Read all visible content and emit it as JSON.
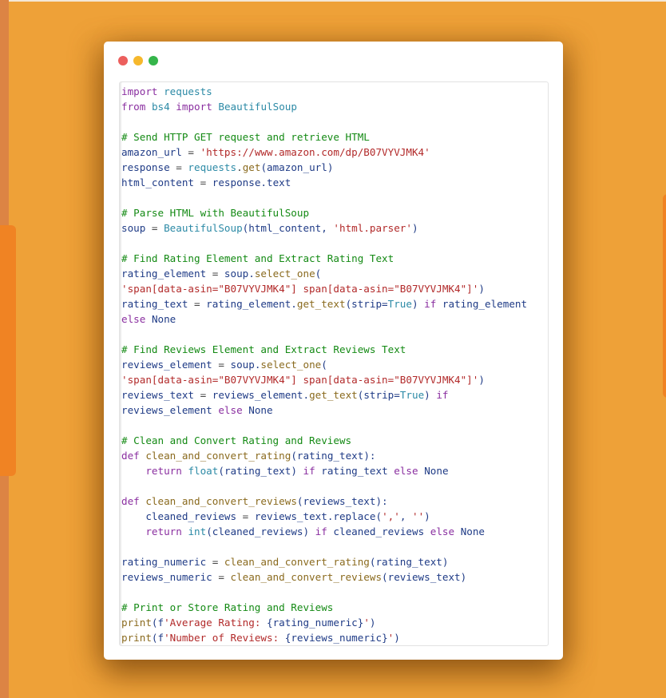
{
  "window": {
    "controls": [
      "close",
      "minimize",
      "maximize"
    ],
    "colors": {
      "close": "#ec5f5d",
      "minimize": "#f6b82c",
      "maximize": "#35b54a"
    }
  },
  "theme": {
    "background": "#eea138",
    "accent_tab": "#f08323",
    "comment": "#148a14",
    "keyword": "#8a2fa0",
    "string": "#b22a2a",
    "identifier": "#1f3b86"
  },
  "code": {
    "language": "python",
    "lines": [
      [
        {
          "t": "kw",
          "v": "import"
        },
        {
          "t": "op",
          "v": " "
        },
        {
          "t": "mod",
          "v": "requests"
        }
      ],
      [
        {
          "t": "kw",
          "v": "from"
        },
        {
          "t": "op",
          "v": " "
        },
        {
          "t": "mod",
          "v": "bs4"
        },
        {
          "t": "op",
          "v": " "
        },
        {
          "t": "kw",
          "v": "import"
        },
        {
          "t": "op",
          "v": " "
        },
        {
          "t": "mod",
          "v": "BeautifulSoup"
        }
      ],
      [],
      [
        {
          "t": "cm",
          "v": "# Send HTTP GET request and retrieve HTML"
        }
      ],
      [
        {
          "t": "id",
          "v": "amazon_url"
        },
        {
          "t": "op",
          "v": " = "
        },
        {
          "t": "str",
          "v": "'https://www.amazon.com/dp/B07VYVJMK4'"
        }
      ],
      [
        {
          "t": "id",
          "v": "response"
        },
        {
          "t": "op",
          "v": " = "
        },
        {
          "t": "mod",
          "v": "requests"
        },
        {
          "t": "op",
          "v": "."
        },
        {
          "t": "fn",
          "v": "get"
        },
        {
          "t": "id",
          "v": "(amazon_url)"
        }
      ],
      [
        {
          "t": "id",
          "v": "html_content"
        },
        {
          "t": "op",
          "v": " = "
        },
        {
          "t": "id",
          "v": "response.text"
        }
      ],
      [],
      [
        {
          "t": "cm",
          "v": "# Parse HTML with BeautifulSoup"
        }
      ],
      [
        {
          "t": "id",
          "v": "soup"
        },
        {
          "t": "op",
          "v": " = "
        },
        {
          "t": "mod",
          "v": "BeautifulSoup"
        },
        {
          "t": "id",
          "v": "(html_content, "
        },
        {
          "t": "str",
          "v": "'html.parser'"
        },
        {
          "t": "id",
          "v": ")"
        }
      ],
      [],
      [
        {
          "t": "cm",
          "v": "# Find Rating Element and Extract Rating Text"
        }
      ],
      [
        {
          "t": "id",
          "v": "rating_element"
        },
        {
          "t": "op",
          "v": " = "
        },
        {
          "t": "id",
          "v": "soup."
        },
        {
          "t": "fn",
          "v": "select_one"
        },
        {
          "t": "id",
          "v": "("
        }
      ],
      [
        {
          "t": "str",
          "v": "'span[data-asin=\"B07VYVJMK4\"] span[data-asin=\"B07VYVJMK4\"]'"
        },
        {
          "t": "id",
          "v": ")"
        }
      ],
      [
        {
          "t": "id",
          "v": "rating_text"
        },
        {
          "t": "op",
          "v": " = "
        },
        {
          "t": "id",
          "v": "rating_element."
        },
        {
          "t": "fn",
          "v": "get_text"
        },
        {
          "t": "id",
          "v": "(strip="
        },
        {
          "t": "mod",
          "v": "True"
        },
        {
          "t": "id",
          "v": ") "
        },
        {
          "t": "kw",
          "v": "if"
        },
        {
          "t": "id",
          "v": " rating_element"
        }
      ],
      [
        {
          "t": "kw",
          "v": "else"
        },
        {
          "t": "op",
          "v": " "
        },
        {
          "t": "id",
          "v": "None"
        }
      ],
      [],
      [
        {
          "t": "cm",
          "v": "# Find Reviews Element and Extract Reviews Text"
        }
      ],
      [
        {
          "t": "id",
          "v": "reviews_element"
        },
        {
          "t": "op",
          "v": " = "
        },
        {
          "t": "id",
          "v": "soup."
        },
        {
          "t": "fn",
          "v": "select_one"
        },
        {
          "t": "id",
          "v": "("
        }
      ],
      [
        {
          "t": "str",
          "v": "'span[data-asin=\"B07VYVJMK4\"] span[data-asin=\"B07VYVJMK4\"]'"
        },
        {
          "t": "id",
          "v": ")"
        }
      ],
      [
        {
          "t": "id",
          "v": "reviews_text"
        },
        {
          "t": "op",
          "v": " = "
        },
        {
          "t": "id",
          "v": "reviews_element."
        },
        {
          "t": "fn",
          "v": "get_text"
        },
        {
          "t": "id",
          "v": "(strip="
        },
        {
          "t": "mod",
          "v": "True"
        },
        {
          "t": "id",
          "v": ") "
        },
        {
          "t": "kw",
          "v": "if"
        }
      ],
      [
        {
          "t": "id",
          "v": "reviews_element "
        },
        {
          "t": "kw",
          "v": "else"
        },
        {
          "t": "op",
          "v": " "
        },
        {
          "t": "id",
          "v": "None"
        }
      ],
      [],
      [
        {
          "t": "cm",
          "v": "# Clean and Convert Rating and Reviews"
        }
      ],
      [
        {
          "t": "kw",
          "v": "def"
        },
        {
          "t": "op",
          "v": " "
        },
        {
          "t": "fn",
          "v": "clean_and_convert_rating"
        },
        {
          "t": "id",
          "v": "(rating_text):"
        }
      ],
      [
        {
          "t": "op",
          "v": "    "
        },
        {
          "t": "kw",
          "v": "return"
        },
        {
          "t": "op",
          "v": " "
        },
        {
          "t": "mod",
          "v": "float"
        },
        {
          "t": "id",
          "v": "(rating_text) "
        },
        {
          "t": "kw",
          "v": "if"
        },
        {
          "t": "id",
          "v": " rating_text "
        },
        {
          "t": "kw",
          "v": "else"
        },
        {
          "t": "op",
          "v": " "
        },
        {
          "t": "id",
          "v": "None"
        }
      ],
      [],
      [
        {
          "t": "kw",
          "v": "def"
        },
        {
          "t": "op",
          "v": " "
        },
        {
          "t": "fn",
          "v": "clean_and_convert_reviews"
        },
        {
          "t": "id",
          "v": "(reviews_text):"
        }
      ],
      [
        {
          "t": "op",
          "v": "    "
        },
        {
          "t": "id",
          "v": "cleaned_reviews"
        },
        {
          "t": "op",
          "v": " = "
        },
        {
          "t": "id",
          "v": "reviews_text.replace("
        },
        {
          "t": "str",
          "v": "','"
        },
        {
          "t": "id",
          "v": ", "
        },
        {
          "t": "str",
          "v": "''"
        },
        {
          "t": "id",
          "v": ")"
        }
      ],
      [
        {
          "t": "op",
          "v": "    "
        },
        {
          "t": "kw",
          "v": "return"
        },
        {
          "t": "op",
          "v": " "
        },
        {
          "t": "mod",
          "v": "int"
        },
        {
          "t": "id",
          "v": "(cleaned_reviews) "
        },
        {
          "t": "kw",
          "v": "if"
        },
        {
          "t": "id",
          "v": " cleaned_reviews "
        },
        {
          "t": "kw",
          "v": "else"
        },
        {
          "t": "op",
          "v": " "
        },
        {
          "t": "id",
          "v": "None"
        }
      ],
      [],
      [
        {
          "t": "id",
          "v": "rating_numeric"
        },
        {
          "t": "op",
          "v": " = "
        },
        {
          "t": "fn",
          "v": "clean_and_convert_rating"
        },
        {
          "t": "id",
          "v": "(rating_text)"
        }
      ],
      [
        {
          "t": "id",
          "v": "reviews_numeric"
        },
        {
          "t": "op",
          "v": " = "
        },
        {
          "t": "fn",
          "v": "clean_and_convert_reviews"
        },
        {
          "t": "id",
          "v": "(reviews_text)"
        }
      ],
      [],
      [
        {
          "t": "cm",
          "v": "# Print or Store Rating and Reviews"
        }
      ],
      [
        {
          "t": "fn",
          "v": "print"
        },
        {
          "t": "id",
          "v": "(f"
        },
        {
          "t": "str",
          "v": "'Average Rating: "
        },
        {
          "t": "id",
          "v": "{rating_numeric}"
        },
        {
          "t": "str",
          "v": "'"
        },
        {
          "t": "id",
          "v": ")"
        }
      ],
      [
        {
          "t": "fn",
          "v": "print"
        },
        {
          "t": "id",
          "v": "(f"
        },
        {
          "t": "str",
          "v": "'Number of Reviews: "
        },
        {
          "t": "id",
          "v": "{reviews_numeric}"
        },
        {
          "t": "str",
          "v": "'"
        },
        {
          "t": "id",
          "v": ")"
        }
      ]
    ]
  }
}
